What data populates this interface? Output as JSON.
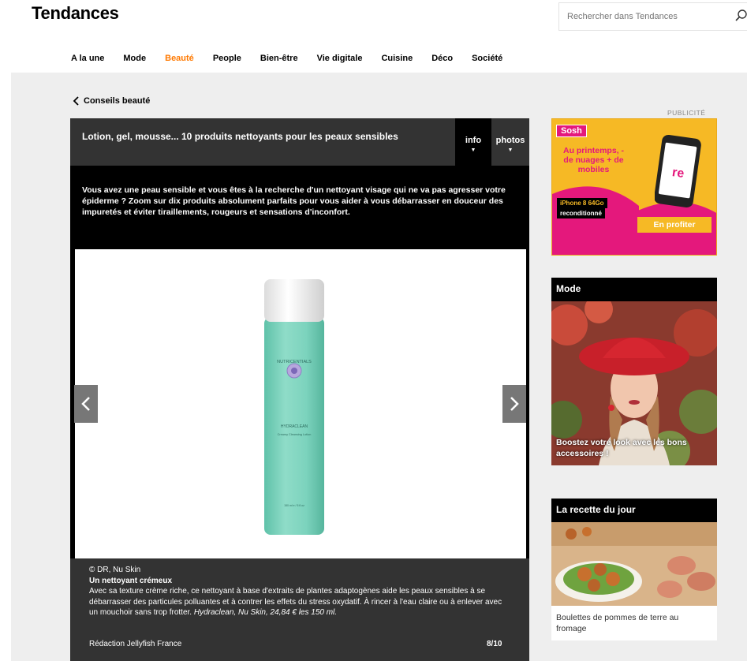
{
  "site": {
    "title": "Tendances"
  },
  "search": {
    "placeholder": "Rechercher dans Tendances"
  },
  "nav": {
    "items": [
      {
        "label": "A la une"
      },
      {
        "label": "Mode"
      },
      {
        "label": "Beauté"
      },
      {
        "label": "People"
      },
      {
        "label": "Bien-être"
      },
      {
        "label": "Vie digitale"
      },
      {
        "label": "Cuisine"
      },
      {
        "label": "Déco"
      },
      {
        "label": "Société"
      }
    ],
    "active": "Beauté"
  },
  "breadcrumb": {
    "label": "Conseils beauté"
  },
  "article": {
    "title": "Lotion, gel, mousse... 10 produits nettoyants pour les peaux sensibles",
    "tabs": {
      "info": "info",
      "photos": "photos"
    },
    "intro": "Vous avez une peau sensible et vous êtes à la recherche d'un nettoyant visage qui ne va pas agresser votre épiderme ? Zoom sur dix produits absolument parfaits pour vous aider à vous débarrasser en douceur des impuretés et éviter tiraillements, rougeurs et sensations d'inconfort.",
    "product": {
      "brand": "NUTRICENTIALS",
      "name": "HYDRACLEAN",
      "subtitle": "Creamy Cleansing Lotion",
      "volume": "150 ml e / 5 fl.oz"
    },
    "caption": {
      "credit": "© DR, Nu Skin",
      "subtitle": "Un nettoyant crémeux",
      "body": "Avec sa texture crème riche, ce nettoyant à base d'extraits de plantes adaptogènes aide les peaux sensibles à se débarrasser des particules polluantes et à contrer les effets du stress oxydatif. À rincer à l'eau claire ou à enlever avec un mouchoir sans trop frotter. ",
      "body_em": "Hydraclean, Nu Skin, 24,84 € les 150 ml.",
      "footer": "Rédaction Jellyfish France",
      "counter": "8/10"
    }
  },
  "sidebar": {
    "pub_label": "PUBLICITÉ",
    "ad": {
      "brand": "Sosh",
      "headline": "Au printemps, - de nuages + de mobiles",
      "product": "iPhone 8 64Go",
      "condition": "reconditionné",
      "cta": "En profiter",
      "logo": "re"
    },
    "mode_card": {
      "header": "Mode",
      "overlay": "Boostez votre look avec les bons accessoires !"
    },
    "recipe_card": {
      "header": "La recette du jour",
      "title": "Boulettes de pommes de terre au fromage"
    }
  },
  "colors": {
    "accent": "#ff7900",
    "bottle": "#7cd3bd",
    "ad_yellow": "#f6b925",
    "ad_pink": "#e4187c"
  }
}
